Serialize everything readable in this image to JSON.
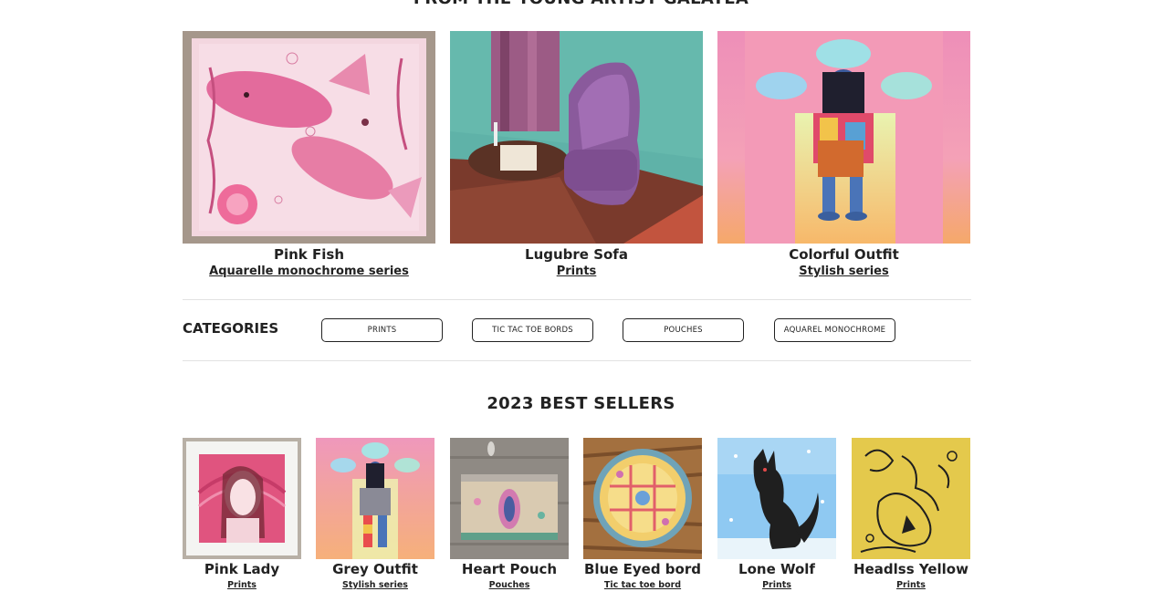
{
  "featured": {
    "title": "FROM THE YOUNG ARTIST GALATEA",
    "items": [
      {
        "name": "Pink Fish",
        "category": "Aquarelle monochrome series"
      },
      {
        "name": "Lugubre Sofa",
        "category": "Prints"
      },
      {
        "name": "Colorful Outfit",
        "category": "Stylish series"
      }
    ]
  },
  "categories": {
    "label": "CATEGORIES",
    "items": [
      "PRINTS",
      "TIC TAC TOE BORDS",
      "POUCHES",
      "AQUAREL MONOCHROME"
    ]
  },
  "best_sellers": {
    "title": "2023 BEST SELLERS",
    "items": [
      {
        "name": "Pink Lady",
        "category": "Prints"
      },
      {
        "name": "Grey Outfit",
        "category": "Stylish series"
      },
      {
        "name": "Heart Pouch",
        "category": "Pouches"
      },
      {
        "name": "Blue Eyed bord",
        "category": "Tic tac toe bord"
      },
      {
        "name": "Lone Wolf",
        "category": "Prints"
      },
      {
        "name": "Headlss Yellow",
        "category": "Prints"
      }
    ]
  },
  "colors": {
    "text": "#222222",
    "pink": "#e36b9c",
    "teal": "#5fb2a8",
    "wolf_blue": "#8fc9f2",
    "yellow": "#e4c94c"
  }
}
